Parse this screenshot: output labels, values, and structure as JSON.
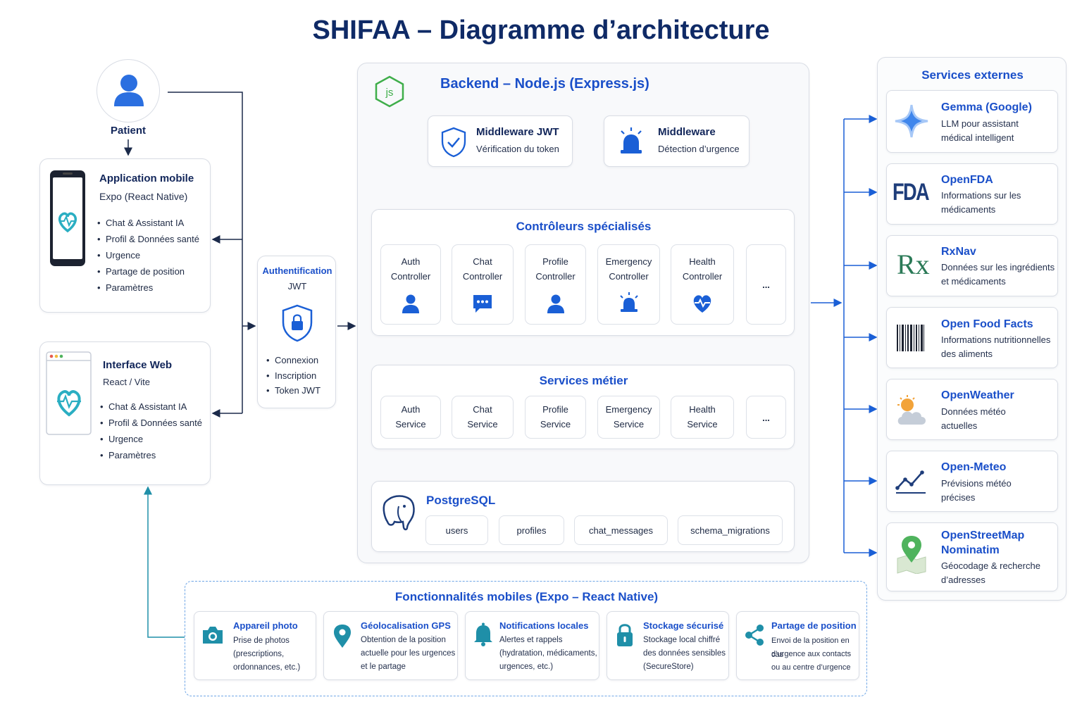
{
  "title": "SHIFAA – Diagramme d’architecture",
  "patient": {
    "label": "Patient",
    "icon": "user-icon"
  },
  "mobile_app": {
    "title": "Application mobile",
    "subtitle": "Expo (React Native)",
    "items": [
      "Chat & Assistant IA",
      "Profil & Données santé",
      "Urgence",
      "Partage de position",
      "Paramètres"
    ],
    "icon": "smartphone-heart-icon"
  },
  "web_app": {
    "title": "Interface Web",
    "subtitle": "React / Vite",
    "items": [
      "Chat & Assistant IA",
      "Profil & Données santé",
      "Urgence",
      "Paramètres"
    ],
    "icon": "browser-heart-icon"
  },
  "auth": {
    "title": "Authentification",
    "subtitle": "JWT",
    "items": [
      "Connexion",
      "Inscription",
      "Token JWT"
    ],
    "icon": "shield-lock-icon"
  },
  "backend": {
    "title": "Backend – Node.js (Express.js)",
    "logo_text": "js",
    "middleware_jwt": {
      "title": "Middleware JWT",
      "desc": "Vérification du token",
      "icon": "shield-check-icon"
    },
    "middleware_urgence": {
      "title": "Middleware",
      "desc": "Détection d’urgence",
      "icon": "alarm-icon"
    },
    "controllers": {
      "title": "Contrôleurs spécialisés",
      "items": [
        {
          "line1": "Auth",
          "line2": "Controller",
          "icon": "user-icon"
        },
        {
          "line1": "Chat",
          "line2": "Controller",
          "icon": "chat-icon"
        },
        {
          "line1": "Profile",
          "line2": "Controller",
          "icon": "user-icon"
        },
        {
          "line1": "Emergency",
          "line2": "Controller",
          "icon": "alarm-icon"
        },
        {
          "line1": "Health",
          "line2": "Controller",
          "icon": "heart-pulse-icon"
        }
      ],
      "more": "..."
    },
    "services": {
      "title": "Services métier",
      "items": [
        {
          "line1": "Auth",
          "line2": "Service"
        },
        {
          "line1": "Chat",
          "line2": "Service"
        },
        {
          "line1": "Profile",
          "line2": "Service"
        },
        {
          "line1": "Emergency",
          "line2": "Service"
        },
        {
          "line1": "Health",
          "line2": "Service"
        }
      ],
      "more": "..."
    },
    "database": {
      "title": "PostgreSQL",
      "tables": [
        "users",
        "profiles",
        "chat_messages",
        "schema_migrations"
      ],
      "icon": "postgresql-elephant-icon"
    }
  },
  "external": {
    "title": "Services externes",
    "items": [
      {
        "name": "Gemma (Google)",
        "desc1": "LLM pour assistant",
        "desc2": "médical intelligent",
        "icon": "gemma-star-icon"
      },
      {
        "name": "OpenFDA",
        "desc1": "Informations sur les",
        "desc2": "médicaments",
        "icon": "fda-logo-icon",
        "logo_text": "FDA"
      },
      {
        "name": "RxNav",
        "desc1": "Données sur les ingrédients",
        "desc2": "et médicaments",
        "icon": "rx-icon",
        "logo_text": "Rx"
      },
      {
        "name": "Open Food Facts",
        "desc1": "Informations nutritionnelles",
        "desc2": "des aliments",
        "icon": "barcode-icon"
      },
      {
        "name": "OpenWeather",
        "desc1": "Données météo",
        "desc2": "actuelles",
        "icon": "sun-cloud-icon"
      },
      {
        "name": "Open-Meteo",
        "desc1": "Prévisions météo",
        "desc2": "précises",
        "icon": "trend-chart-icon"
      },
      {
        "name": "OpenStreetMap",
        "name2": "Nominatim",
        "desc1": "Géocodage & recherche",
        "desc2": "d’adresses",
        "icon": "map-pin-icon"
      }
    ]
  },
  "mobile_features": {
    "title": "Fonctionnalités mobiles (Expo – React Native)",
    "items": [
      {
        "title": "Appareil photo",
        "desc": [
          "Prise de photos",
          "(prescriptions,",
          "ordonnances, etc.)"
        ],
        "icon": "camera-icon"
      },
      {
        "title": "Géolocalisation GPS",
        "desc": [
          "Obtention de la position",
          "actuelle pour les urgences",
          "et le partage"
        ],
        "icon": "location-pin-icon"
      },
      {
        "title": "Notifications locales",
        "desc": [
          "Alertes et rappels",
          "(hydratation, médicaments,",
          "urgences, etc.)"
        ],
        "icon": "bell-icon"
      },
      {
        "title": "Stockage sécurisé",
        "desc": [
          "Stockage local chiffré",
          "des données sensibles",
          "(SecureStore)"
        ],
        "icon": "lock-icon"
      },
      {
        "title": "Partage de position",
        "desc": [
          "Envoi de la position en cas",
          "d’urgence aux contacts",
          "ou au centre d’urgence"
        ],
        "icon": "share-icon"
      }
    ]
  },
  "colors": {
    "navy": "#0f2a66",
    "blue": "#1a4fc9",
    "teal": "#1f8fa8",
    "arrow": "#1b2a4a",
    "arrow_blue": "#1a5fd6"
  }
}
